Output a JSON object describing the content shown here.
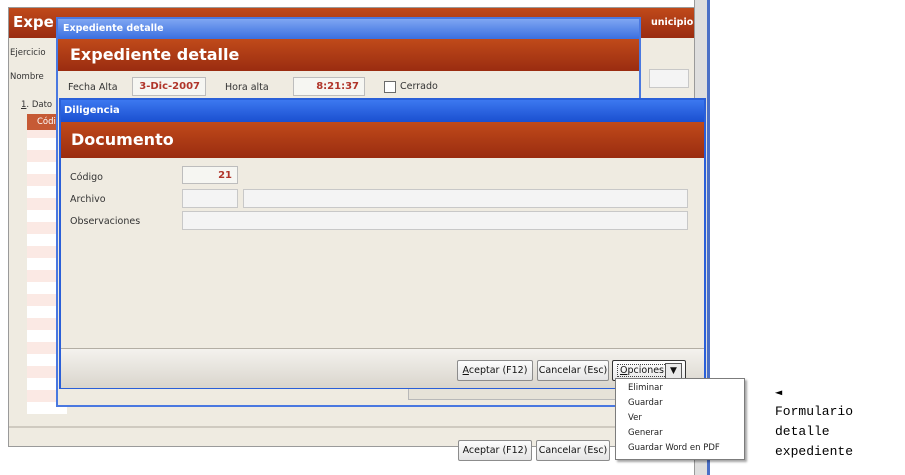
{
  "back_window": {
    "title_partial": "Expe",
    "municipio": "unicipio",
    "ejercicio_label": "Ejercicio",
    "nombre_label": "Nombre",
    "tab_partial_key": "1",
    "tab_partial_rest": ". Dato",
    "col_partial": "Códi",
    "aceptar": "Aceptar (F12)",
    "cancelar": "Cancelar (Esc)"
  },
  "expediente_window": {
    "title": "Expediente detalle",
    "header": "Expediente detalle",
    "fecha_alta_label": "Fecha Alta",
    "fecha_alta_value": "3-Dic-2007",
    "hora_alta_label": "Hora alta",
    "hora_alta_value": "8:21:37",
    "cerrado_label": "Cerrado"
  },
  "diligencia_window": {
    "title": "Diligencia",
    "header": "Documento",
    "codigo_label": "Código",
    "codigo_value": "21",
    "archivo_label": "Archivo",
    "observaciones_label": "Observaciones",
    "aceptar_key": "A",
    "aceptar_rest": "ceptar (F12)",
    "cancelar": "Cancelar (Esc)",
    "opciones_key": "O",
    "opciones_rest": "pciones"
  },
  "opciones_menu": {
    "items": [
      "Eliminar",
      "Guardar",
      "Ver",
      "Generar",
      "Guardar Word en PDF"
    ]
  },
  "caption": {
    "arrow": "◄",
    "lines": [
      "Formulario",
      "detalle",
      "expediente"
    ]
  },
  "colors": {
    "title_bar_blue": "#3a6fe0",
    "header_orange": "#a8361a",
    "form_bg": "#efebe1"
  }
}
